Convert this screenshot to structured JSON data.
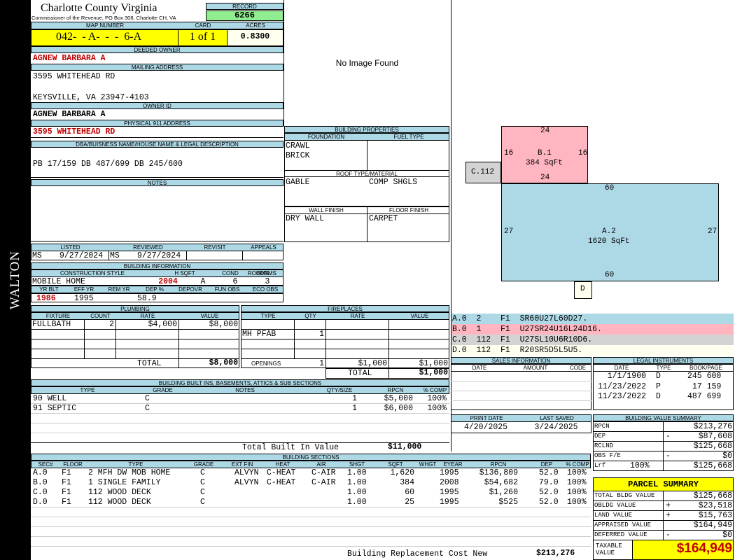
{
  "sidebar": {
    "name": "WALTON"
  },
  "header": {
    "county": "Charlotte County Virginia",
    "commissioner": "Commissioner of the Revenue, PO Box 308, Charlotte CH, VA",
    "record_label": "RECORD",
    "record": "6266",
    "map_number_label": "MAP NUMBER",
    "map_number": "042-  - A-  -  -  6-A",
    "card_label": "CARD",
    "card": "1 of 1",
    "acres_label": "ACRES",
    "acres": "0.8300"
  },
  "owner": {
    "deeded_owner_label": "DEEDED OWNER",
    "deeded_owner": "AGNEW BARBARA A",
    "mailing_label": "MAILING ADDRESS",
    "mailing_line1": "3595 WHITEHEAD RD",
    "mailing_line2": "KEYSVILLE, VA 23947-4103",
    "owner_id_label": "OWNER ID",
    "owner_id": "AGNEW BARBARA A",
    "physical_label": "PHYSICAL 911 ADDRESS",
    "physical": "3595 WHITEHEAD RD",
    "legal_label": "DBA/BUISNESS NAME/HOUSE NAME & LEGAL DESCRIPTION",
    "legal": "PB 17/159 DB 487/699 DB 245/600",
    "notes_label": "NOTES"
  },
  "image": {
    "no_image": "No Image Found"
  },
  "building_properties": {
    "title": "BUILDING PROPERTIES",
    "foundation_label": "FOUNDATION",
    "fuel_label": "FUEL TYPE",
    "foundation1": "CRAWL",
    "foundation2": "BRICK",
    "roof_label": "ROOF TYPE/MATERIAL",
    "roof_type": "GABLE",
    "roof_material": "COMP SHGLS",
    "wall_label": "WALL FINISH",
    "floor_label": "FLOOR FINISH",
    "wall": "DRY WALL",
    "floor": "CARPET"
  },
  "listing": {
    "listed_label": "LISTED",
    "reviewed_label": "REVIEWED",
    "revisit_label": "REVISIT",
    "appeals_label": "APPEALS",
    "listed_by": "MS",
    "listed_date": "9/27/2024",
    "reviewed_by": "MS",
    "reviewed_date": "9/27/2024"
  },
  "building_info": {
    "title": "BUILDING INFORMATION",
    "style_label": "CONSTRUCTION STYLE",
    "hsqft_label": "H SQFT",
    "cond_label": "COND",
    "rooms_label": "ROOMS",
    "bdrms_label": "BDRMS",
    "style": "MOBILE HOME",
    "hsqft": "2004",
    "cond": "A",
    "rooms": "6",
    "bdrms": "3",
    "yrblt_label": "YR BLT",
    "effyr_label": "EFF YR",
    "remyr_label": "REM YR",
    "dep_label": "DEP %",
    "depovr_label": "DEPOVR",
    "funobs_label": "FUN OBS",
    "ecoobs_label": "ECO OBS",
    "yrblt": "1986",
    "effyr": "1995",
    "dep": "58.9"
  },
  "plumbing": {
    "title": "PLUMBING",
    "fixture_label": "FIXTURE",
    "count_label": "COUNT",
    "rate_label": "RATE",
    "value_label": "VALUE",
    "fixture": "FULLBATH",
    "count": "2",
    "rate": "$4,000",
    "value": "$8,000",
    "total_label": "TOTAL",
    "total": "$8,000"
  },
  "fireplaces": {
    "title": "FIREPLACES",
    "type_label": "TYPE",
    "qty_label": "QTY",
    "rate_label": "RATE",
    "value_label": "VALUE",
    "type": "MH PFAB",
    "qty": "1",
    "openings_label": "OPENINGS",
    "openings_qty": "1",
    "openings_rate": "$1,000",
    "openings_value": "$1,000",
    "total_label": "TOTAL",
    "total": "$1,000"
  },
  "built_ins": {
    "title": "BUILDING BUILT INS, BASEMENTS, ATTICS & SUB SECTIONS",
    "headers": {
      "type": "TYPE",
      "grade": "GRADE",
      "notes": "NOTES",
      "qty": "QTY/SIZE",
      "rpcn": "RPCN",
      "comp": "% COMP"
    },
    "rows": [
      {
        "type": "90 WELL",
        "grade": "C",
        "qty": "1",
        "rpcn": "$5,000",
        "comp": "100%"
      },
      {
        "type": "91 SEPTIC",
        "grade": "C",
        "qty": "1",
        "rpcn": "$6,000",
        "comp": "100%"
      }
    ],
    "total_label": "Total Built In Value",
    "total": "$11,000"
  },
  "building_sections": {
    "title": "BUILDING SECTIONS",
    "headers": {
      "sec": "SEC#",
      "floor": "FLOOR",
      "type": "TYPE",
      "grade": "GRADE",
      "extfin": "EXT FIN",
      "heat": "HEAT",
      "air": "AIR",
      "shgt": "SHGT",
      "sqft": "SQFT",
      "whgt": "WHGT",
      "eyear": "EYEAR",
      "rpcn": "RPCN",
      "dep": "DEP",
      "comp": "% COMP"
    },
    "rows": [
      {
        "sec": "A.0",
        "floor": "F1",
        "type": "2 MFH DW MOB HOME",
        "grade": "C",
        "extfin": "ALVYN",
        "heat": "C-HEAT",
        "air": "C-AIR",
        "shgt": "1.00",
        "sqft": "1,620",
        "eyear": "1995",
        "rpcn": "$136,809",
        "dep": "52.0",
        "comp": "100%"
      },
      {
        "sec": "B.0",
        "floor": "F1",
        "type": "1 SINGLE FAMILY",
        "grade": "C",
        "extfin": "ALVYN",
        "heat": "C-HEAT",
        "air": "C-AIR",
        "shgt": "1.00",
        "sqft": "384",
        "eyear": "2008",
        "rpcn": "$54,682",
        "dep": "79.0",
        "comp": "100%"
      },
      {
        "sec": "C.0",
        "floor": "F1",
        "type": "112 WOOD DECK",
        "grade": "C",
        "extfin": "",
        "heat": "",
        "air": "",
        "shgt": "1.00",
        "sqft": "60",
        "eyear": "1995",
        "rpcn": "$1,260",
        "dep": "52.0",
        "comp": "100%"
      },
      {
        "sec": "D.0",
        "floor": "F1",
        "type": "112 WOOD DECK",
        "grade": "C",
        "extfin": "",
        "heat": "",
        "air": "",
        "shgt": "1.00",
        "sqft": "25",
        "eyear": "1995",
        "rpcn": "$525",
        "dep": "52.0",
        "comp": "100%"
      }
    ],
    "rcn_label": "Building Replacement Cost New",
    "rcn": "$213,276"
  },
  "sketch": {
    "b_label": "B.1",
    "b_area": "384 SqFt",
    "b_top": "24",
    "b_bottom": "24",
    "b_left": "16",
    "b_right": "16",
    "a_label": "A.2",
    "a_area": "1620 SqFt",
    "a_top": "60",
    "a_bottom": "60",
    "a_left": "27",
    "a_right": "27",
    "c_label": "C.112",
    "d_label": "D",
    "colors": {
      "b": "#ffb6c1",
      "a": "#add8e6",
      "c": "#d3d3d3",
      "d": "#fffff0"
    }
  },
  "sketch_codes": [
    {
      "code": "A.0  2    F1  SR60U27L60D27.",
      "color": "#add8e6"
    },
    {
      "code": "B.0  1    F1  U27SR24U16L24D16.",
      "color": "#ffb6c1"
    },
    {
      "code": "C.0  112  F1  U27SL10U6R10D6.",
      "color": "#d3d3d3"
    },
    {
      "code": "D.0  112  F1  R20SR5D5L5U5.",
      "color": "#fffff0"
    }
  ],
  "sales": {
    "title": "SALES INFORMATION",
    "date_label": "DATE",
    "amount_label": "AMOUNT",
    "code_label": "CODE"
  },
  "legal_instruments": {
    "title": "LEGAL INSTRUMENTS",
    "date_label": "DATE",
    "type_label": "TYPE",
    "book_label": "BOOK/PAGE",
    "rows": [
      {
        "date": "1/1/1900",
        "type": "D",
        "book": "245 600"
      },
      {
        "date": "11/23/2022",
        "type": "P",
        "book": "17 159"
      },
      {
        "date": "11/23/2022",
        "type": "D",
        "book": "487 699"
      }
    ]
  },
  "print_info": {
    "print_label": "PRINT DATE",
    "saved_label": "LAST SAVED",
    "print_date": "4/20/2025",
    "last_saved": "3/24/2025"
  },
  "value_summary": {
    "title": "BUILDING VALUE SUMMARY",
    "rows": [
      {
        "label": "RPCN",
        "sign": "",
        "value": "$213,276"
      },
      {
        "label": "DEP",
        "sign": "-",
        "value": "$87,608"
      },
      {
        "label": "RCLND",
        "sign": "",
        "value": "$125,668"
      },
      {
        "label": "OBS F/E",
        "sign": "-",
        "value": "$0"
      },
      {
        "label": "Lrf",
        "sign": "100%",
        "value": "$125,668"
      }
    ]
  },
  "parcel_summary": {
    "title": "PARCEL SUMMARY",
    "rows": [
      {
        "label": "TOTAL BLDG VALUE",
        "sign": "",
        "value": "$125,668"
      },
      {
        "label": "OBLDG VALUE",
        "sign": "+",
        "value": "$23,518"
      },
      {
        "label": "LAND VALUE",
        "sign": "+",
        "value": "$15,763"
      },
      {
        "label": "APPRAISED VALUE",
        "sign": "",
        "value": "$164,949"
      },
      {
        "label": "DEFERRED VALUE",
        "sign": "-",
        "value": "$0"
      }
    ],
    "taxable_label": "TAXABLE VALUE",
    "taxable": "$164,949"
  }
}
